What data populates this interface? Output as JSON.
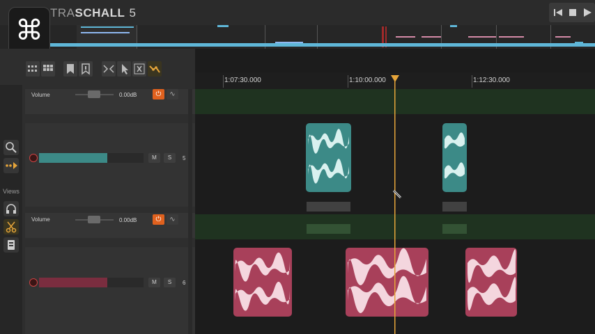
{
  "app": {
    "title_light": "TRA",
    "title_bold": "SCHALL",
    "version": "5",
    "logo_glyph": "⌘"
  },
  "colors": {
    "accent": "#e6a53a",
    "teal_clip": "#3c8a87",
    "red_clip": "#a8405a",
    "power_on": "#e0611e",
    "overview_blue": "#5fb7d8"
  },
  "transport": {
    "buttons": [
      "skip-to-start-icon",
      "stop-icon",
      "play-icon"
    ]
  },
  "toolbar": {
    "tools": [
      "grid-small-icon",
      "grid-large-icon",
      "bookmark-icon",
      "bookmark-add-icon",
      "split-icon",
      "cursor-select-icon",
      "cursor-range-icon",
      "wave-edit-icon"
    ]
  },
  "sidebar": {
    "views_label": "Views",
    "items": [
      "zoom-icon",
      "follow-playhead-icon",
      "headphones-icon",
      "scissors-icon",
      "clip-icon"
    ]
  },
  "ruler": {
    "labels": [
      "1:07:30.000",
      "1:10:00.000",
      "1:12:30.000"
    ]
  },
  "tracks": [
    {
      "number": "5",
      "volume_label": "Volume",
      "volume_db": "0.00dB",
      "mute_label": "M",
      "solo_label": "S",
      "meter_fill": 0.65,
      "color": "#3c8a87"
    },
    {
      "number": "6",
      "volume_label": "Volume",
      "volume_db": "0.00dB",
      "mute_label": "M",
      "solo_label": "S",
      "meter_fill": 0.65,
      "color": "#a8405a"
    }
  ]
}
